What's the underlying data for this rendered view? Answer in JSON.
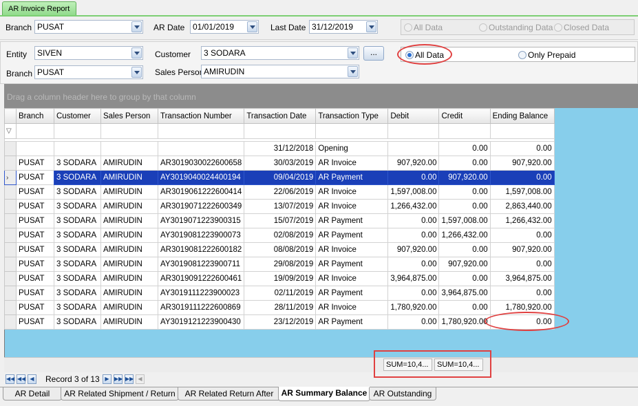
{
  "window": {
    "tab_title": "AR Invoice Report"
  },
  "filters_top": {
    "branch_label": "Branch",
    "branch_value": "PUSAT",
    "ardate_label": "AR Date",
    "ardate_value": "01/01/2019",
    "lastdate_label": "Last Date",
    "lastdate_value": "31/12/2019",
    "status_options": [
      "All Data",
      "Outstanding Data",
      "Closed Data"
    ]
  },
  "filters_main": {
    "entity_label": "Entity",
    "entity_value": "SIVEN",
    "branch_label": "Branch",
    "branch_value": "PUSAT",
    "customer_label": "Customer",
    "customer_value": "3 SODARA",
    "salesperson_label": "Sales Person",
    "salesperson_value": "AMIRUDIN",
    "ellipsis_label": "...",
    "data_options": [
      "All Data",
      "Only Prepaid"
    ]
  },
  "grid": {
    "group_hint": "Drag a column header here to group by that column",
    "columns": [
      "Branch",
      "Customer",
      "Sales Person",
      "Transaction Number",
      "Transaction Date",
      "Transaction Type",
      "Debit",
      "Credit",
      "Ending Balance"
    ],
    "rows": [
      [
        "",
        "",
        "",
        "",
        "31/12/2018",
        "Opening",
        "",
        "0.00",
        "0.00"
      ],
      [
        "PUSAT",
        "3 SODARA",
        "AMIRUDIN",
        "AR3019030022600658",
        "30/03/2019",
        "AR Invoice",
        "907,920.00",
        "0.00",
        "907,920.00"
      ],
      [
        "PUSAT",
        "3 SODARA",
        "AMIRUDIN",
        "AY3019040024400194",
        "09/04/2019",
        "AR Payment",
        "0.00",
        "907,920.00",
        "0.00"
      ],
      [
        "PUSAT",
        "3 SODARA",
        "AMIRUDIN",
        "AR3019061222600414",
        "22/06/2019",
        "AR Invoice",
        "1,597,008.00",
        "0.00",
        "1,597,008.00"
      ],
      [
        "PUSAT",
        "3 SODARA",
        "AMIRUDIN",
        "AR3019071222600349",
        "13/07/2019",
        "AR Invoice",
        "1,266,432.00",
        "0.00",
        "2,863,440.00"
      ],
      [
        "PUSAT",
        "3 SODARA",
        "AMIRUDIN",
        "AY3019071223900315",
        "15/07/2019",
        "AR Payment",
        "0.00",
        "1,597,008.00",
        "1,266,432.00"
      ],
      [
        "PUSAT",
        "3 SODARA",
        "AMIRUDIN",
        "AY3019081223900073",
        "02/08/2019",
        "AR Payment",
        "0.00",
        "1,266,432.00",
        "0.00"
      ],
      [
        "PUSAT",
        "3 SODARA",
        "AMIRUDIN",
        "AR3019081222600182",
        "08/08/2019",
        "AR Invoice",
        "907,920.00",
        "0.00",
        "907,920.00"
      ],
      [
        "PUSAT",
        "3 SODARA",
        "AMIRUDIN",
        "AY3019081223900711",
        "29/08/2019",
        "AR Payment",
        "0.00",
        "907,920.00",
        "0.00"
      ],
      [
        "PUSAT",
        "3 SODARA",
        "AMIRUDIN",
        "AR3019091222600461",
        "19/09/2019",
        "AR Invoice",
        "3,964,875.00",
        "0.00",
        "3,964,875.00"
      ],
      [
        "PUSAT",
        "3 SODARA",
        "AMIRUDIN",
        "AY3019111223900023",
        "02/11/2019",
        "AR Payment",
        "0.00",
        "3,964,875.00",
        "0.00"
      ],
      [
        "PUSAT",
        "3 SODARA",
        "AMIRUDIN",
        "AR3019111222600869",
        "28/11/2019",
        "AR Invoice",
        "1,780,920.00",
        "0.00",
        "1,780,920.00"
      ],
      [
        "PUSAT",
        "3 SODARA",
        "AMIRUDIN",
        "AY3019121223900430",
        "23/12/2019",
        "AR Payment",
        "0.00",
        "1,780,920.00",
        "0.00"
      ]
    ],
    "selected_row": 2,
    "summary": {
      "debit_sum": "SUM=10,4...",
      "credit_sum": "SUM=10,4..."
    }
  },
  "navigator": {
    "record_text": "Record 3 of 13"
  },
  "bottom_tabs": [
    "AR Detail",
    "AR Related Shipment / Return",
    "AR Related Return After",
    "AR Summary Balance",
    "AR Outstanding"
  ],
  "active_bottom_tab": "AR Summary Balance",
  "colors": {
    "selection": "#1a3fb8",
    "empty_area": "#87ceeb",
    "annotation": "#e04040",
    "tab_green": "#8fd98a"
  }
}
